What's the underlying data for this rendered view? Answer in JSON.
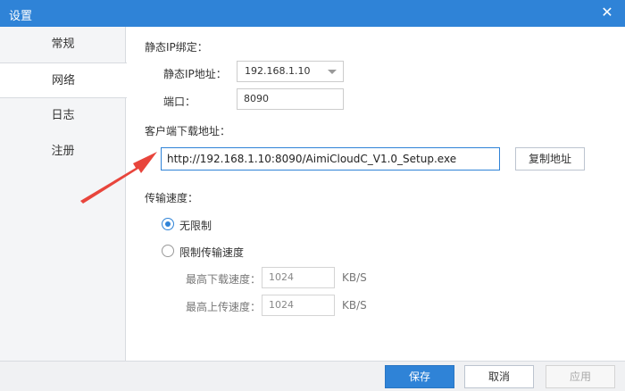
{
  "window": {
    "title": "设置",
    "close_glyph": "✕"
  },
  "sidebar": {
    "items": [
      {
        "label": "常规"
      },
      {
        "label": "网络"
      },
      {
        "label": "日志"
      },
      {
        "label": "注册"
      }
    ],
    "active": "网络"
  },
  "static_ip": {
    "section_label": "静态IP绑定：",
    "address_label": "静态IP地址：",
    "address_value": "192.168.1.10",
    "port_label": "端口：",
    "port_value": "8090"
  },
  "download": {
    "section_label": "客户端下载地址：",
    "url": "http://192.168.1.10:8090/AimiCloudC_V1.0_Setup.exe",
    "copy_label": "复制地址"
  },
  "speed": {
    "section_label": "传输速度：",
    "option_unlimited": "无限制",
    "option_limited": "限制传输速度",
    "selected": "无限制",
    "max_download_label": "最高下载速度：",
    "max_download_value": "1024",
    "max_upload_label": "最高上传速度：",
    "max_upload_value": "1024",
    "unit": "KB/S"
  },
  "footer": {
    "save_label": "保存",
    "cancel_label": "取消",
    "apply_label": "应用"
  },
  "colors": {
    "accent": "#2f83d7",
    "annotation_arrow": "#e8453c"
  },
  "annotation": {
    "icon": "red-pointer-arrow-icon"
  }
}
